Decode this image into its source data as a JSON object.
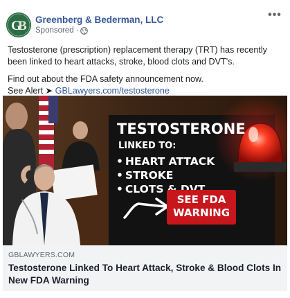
{
  "header": {
    "page_name": "Greenberg & Bederman, LLC",
    "sponsored": "Sponsored",
    "separator": "·",
    "avatar_initials": "GB",
    "more_label": "•••"
  },
  "post": {
    "paragraph1": "Testosterone (prescription) replacement therapy (TRT) has recently been linked to heart attacks, stroke, blood clots and DVT's.",
    "paragraph2": "Find out about the FDA safety announcement now.",
    "see_alert_label": "See Alert",
    "arrow": "➤",
    "see_alert_link": "GBLawyers.com/testosterone"
  },
  "ad_image": {
    "title": "TESTOSTERONE",
    "linked_to": "LINKED TO:",
    "bullets": [
      "HEART ATTACK",
      "STROKE",
      "CLOTS & DVT"
    ],
    "warning_line1": "SEE FDA",
    "warning_line2": "WARNING",
    "colors": {
      "warning_red": "#c8161d",
      "panel_dark": "#121212",
      "siren_red": "#e0231c"
    }
  },
  "link_preview": {
    "domain": "GBLAWYERS.COM",
    "headline": "Testosterone Linked To Heart Attack, Stroke & Blood Clots In New FDA Warning"
  },
  "colors": {
    "link_blue": "#385898",
    "meta_gray": "#606770",
    "preview_bg": "#f2f3f5"
  }
}
